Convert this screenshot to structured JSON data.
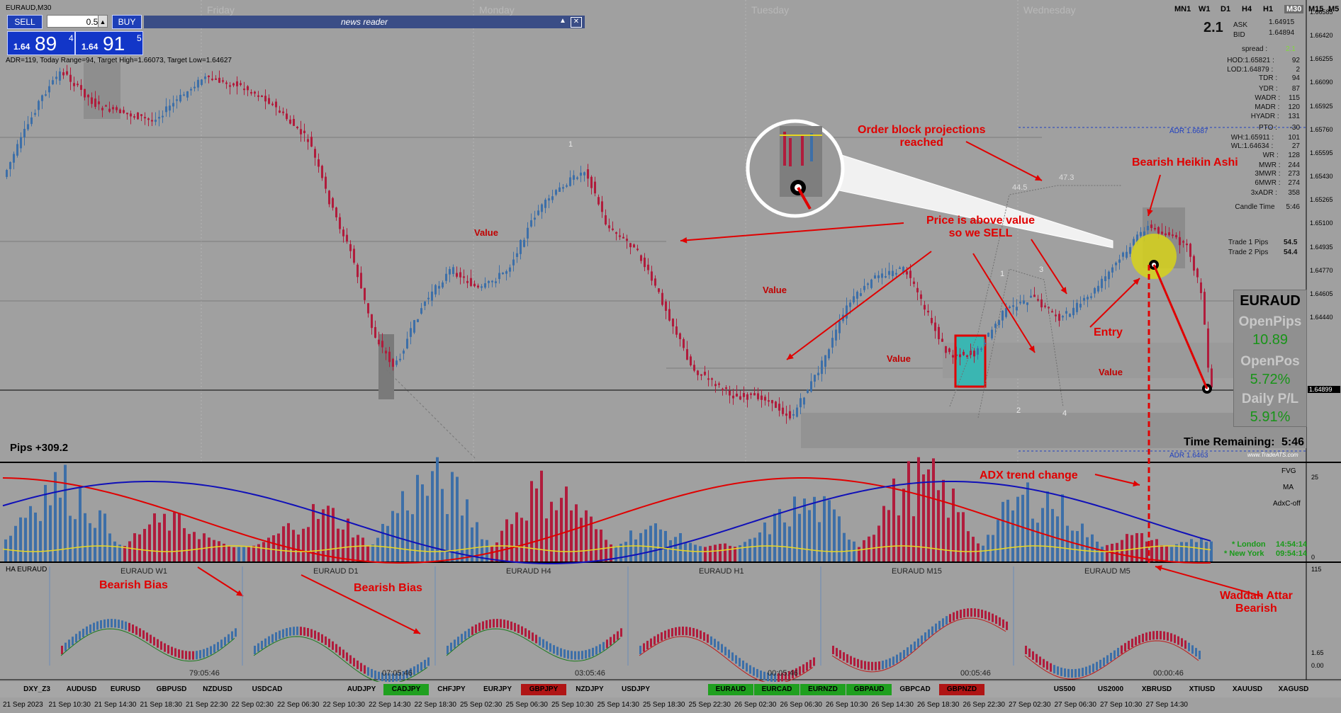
{
  "window": {
    "title": "EURAUD,M30"
  },
  "timeframes": [
    {
      "label": "MN1",
      "active": false
    },
    {
      "label": "W1",
      "active": false
    },
    {
      "label": "D1",
      "active": false
    },
    {
      "label": "H4",
      "active": false
    },
    {
      "label": "H1",
      "active": false
    },
    {
      "label": "M30",
      "active": true
    },
    {
      "label": "M15",
      "active": false
    },
    {
      "label": "M5",
      "active": false
    }
  ],
  "trade_panel": {
    "sell_label": "SELL",
    "buy_label": "BUY",
    "lot": "0.50",
    "sell_price": {
      "pre": "1.64",
      "big": "89",
      "sup": "4"
    },
    "buy_price": {
      "pre": "1.64",
      "big": "91",
      "sup": "5"
    }
  },
  "news_reader": {
    "title": "news reader"
  },
  "adr_info": "ADR=119, Today Range=94, Target High=1.66073, Target Low=1.64627",
  "day_labels": [
    "Friday",
    "Monday",
    "Tuesday",
    "Wednesday"
  ],
  "info_panel": {
    "spread_ratio": "2.1",
    "ask_label": "ASK",
    "ask": "1.64915",
    "bid_label": "BID",
    "bid": "1.64894",
    "spread_label": "spread :",
    "spread": "2.1",
    "rows": [
      {
        "k": "HOD:1.65821 :",
        "v": "92"
      },
      {
        "k": "LOD:1.64879 :",
        "v": "2"
      },
      {
        "k": "TDR :",
        "v": "94"
      },
      {
        "k": "YDR :",
        "v": "87"
      },
      {
        "k": "WADR :",
        "v": "115"
      },
      {
        "k": "MADR :",
        "v": "120"
      },
      {
        "k": "HYADR :",
        "v": "131"
      },
      {
        "k": "PTO :",
        "v": "-30"
      },
      {
        "k": "WH:1.65911 :",
        "v": "101"
      },
      {
        "k": "WL:1.64634 :",
        "v": "27"
      },
      {
        "k": "WR :",
        "v": "128"
      },
      {
        "k": "MWR :",
        "v": "244"
      },
      {
        "k": "3MWR :",
        "v": "273"
      },
      {
        "k": "6MWR :",
        "v": "274"
      },
      {
        "k": "3xADR :",
        "v": "358"
      },
      {
        "k": "Candle Time",
        "v": "5:46"
      }
    ],
    "trade1_label": "Trade 1 Pips",
    "trade1": "54.5",
    "trade2_label": "Trade 2 Pips",
    "trade2": "54.4"
  },
  "stats_box": {
    "symbol": "EURAUD",
    "open_pips_label": "OpenPips",
    "open_pips": "10.89",
    "open_pos_label": "OpenPos",
    "open_pos": "5.72%",
    "daily_pl_label": "Daily P/L",
    "daily_pl": "5.91%"
  },
  "time_remaining": {
    "label": "Time Remaining:",
    "value": "5:46"
  },
  "watermark": "www.TradeATS.com",
  "pips_total": "Pips +309.2",
  "adr_high_label": "ADR 1.6687",
  "adr_low_label": "ADR 1.6463",
  "current_price_label": "1.64899",
  "price_axis": [
    "1.66585",
    "1.66420",
    "1.66255",
    "1.66090",
    "1.65925",
    "1.65760",
    "1.65595",
    "1.65430",
    "1.65265",
    "1.65100",
    "1.64935",
    "1.64770",
    "1.64605",
    "1.64440"
  ],
  "annotations": {
    "order_block": "Order block projections\nreached",
    "bearish_ha": "Bearish Heikin Ashi",
    "price_above": "Price is above value\nso we SELL",
    "entry": "Entry",
    "adx": "ADX trend change",
    "waddah": "Waddah Attar\nBearish",
    "bearish_bias_1": "Bearish Bias",
    "bearish_bias_2": "Bearish Bias"
  },
  "value_labels": [
    "Value",
    "Value",
    "Value",
    "Value"
  ],
  "ob_numbers": [
    "1",
    "1",
    "2",
    "3",
    "4",
    "44.5",
    "47.3"
  ],
  "indicator_panel": {
    "fvg": "FVG",
    "ma": "MA",
    "adx": "AdxC-off",
    "sessions": [
      {
        "name": "* London",
        "time": "14:54:14"
      },
      {
        "name": "* New York",
        "time": "09:54:14"
      }
    ],
    "axis_top": "25",
    "axis_bottom": "0"
  },
  "ha_panel": {
    "title": "HA EURAUD",
    "axis_top": "115",
    "axis_mid": "1.65",
    "axis_bottom": "0.00",
    "minis": [
      {
        "title": "EURAUD W1",
        "time": "79:05:46"
      },
      {
        "title": "EURAUD D1",
        "time": "07:05:46"
      },
      {
        "title": "EURAUD H4",
        "time": "03:05:46"
      },
      {
        "title": "EURAUD H1",
        "time": "00:05:46"
      },
      {
        "title": "EURAUD M15",
        "time": "00:05:46"
      },
      {
        "title": "EURAUD M5",
        "time": "00:00:46"
      }
    ]
  },
  "symbols": [
    {
      "label": "DXY_Z3",
      "state": "none"
    },
    {
      "label": "AUDUSD",
      "state": "none"
    },
    {
      "label": "EURUSD",
      "state": "none"
    },
    {
      "label": "GBPUSD",
      "state": "none"
    },
    {
      "label": "NZDUSD",
      "state": "none"
    },
    {
      "label": "USDCAD",
      "state": "none"
    },
    {
      "label": "AUDJPY",
      "state": "none"
    },
    {
      "label": "CADJPY",
      "state": "green"
    },
    {
      "label": "CHFJPY",
      "state": "none"
    },
    {
      "label": "EURJPY",
      "state": "none"
    },
    {
      "label": "GBPJPY",
      "state": "red"
    },
    {
      "label": "NZDJPY",
      "state": "none"
    },
    {
      "label": "USDJPY",
      "state": "none"
    },
    {
      "label": "EURAUD",
      "state": "green"
    },
    {
      "label": "EURCAD",
      "state": "green"
    },
    {
      "label": "EURNZD",
      "state": "green"
    },
    {
      "label": "GBPAUD",
      "state": "green"
    },
    {
      "label": "GBPCAD",
      "state": "none"
    },
    {
      "label": "GBPNZD",
      "state": "red"
    },
    {
      "label": "US500",
      "state": "none"
    },
    {
      "label": "US2000",
      "state": "none"
    },
    {
      "label": "XBRUSD",
      "state": "none"
    },
    {
      "label": "XTIUSD",
      "state": "none"
    },
    {
      "label": "XAUUSD",
      "state": "none"
    },
    {
      "label": "XAGUSD",
      "state": "none"
    }
  ],
  "date_axis": [
    "21 Sep 2023",
    "21 Sep 10:30",
    "21 Sep 14:30",
    "21 Sep 18:30",
    "21 Sep 22:30",
    "22 Sep 02:30",
    "22 Sep 06:30",
    "22 Sep 10:30",
    "22 Sep 14:30",
    "22 Sep 18:30",
    "25 Sep 02:30",
    "25 Sep 06:30",
    "25 Sep 10:30",
    "25 Sep 14:30",
    "25 Sep 18:30",
    "25 Sep 22:30",
    "26 Sep 02:30",
    "26 Sep 06:30",
    "26 Sep 10:30",
    "26 Sep 14:30",
    "26 Sep 18:30",
    "26 Sep 22:30",
    "27 Sep 02:30",
    "27 Sep 06:30",
    "27 Sep 10:30",
    "27 Sep 14:30"
  ],
  "colors": {
    "bull": "#3d6fa8",
    "bear": "#b01c3c",
    "accent": "#e00000",
    "panel_bg": "#a0a0a0"
  }
}
